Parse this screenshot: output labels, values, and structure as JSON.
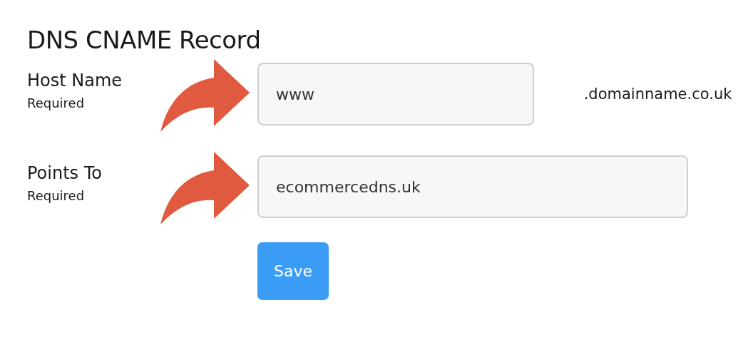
{
  "title": "DNS CNAME Record",
  "fields": [
    {
      "label": "Host Name",
      "hint": "Required",
      "value": "www",
      "suffix": ".domainname.co.uk"
    },
    {
      "label": "Points To",
      "hint": "Required",
      "value": "ecommercedns.uk"
    }
  ],
  "save_button": "Save"
}
